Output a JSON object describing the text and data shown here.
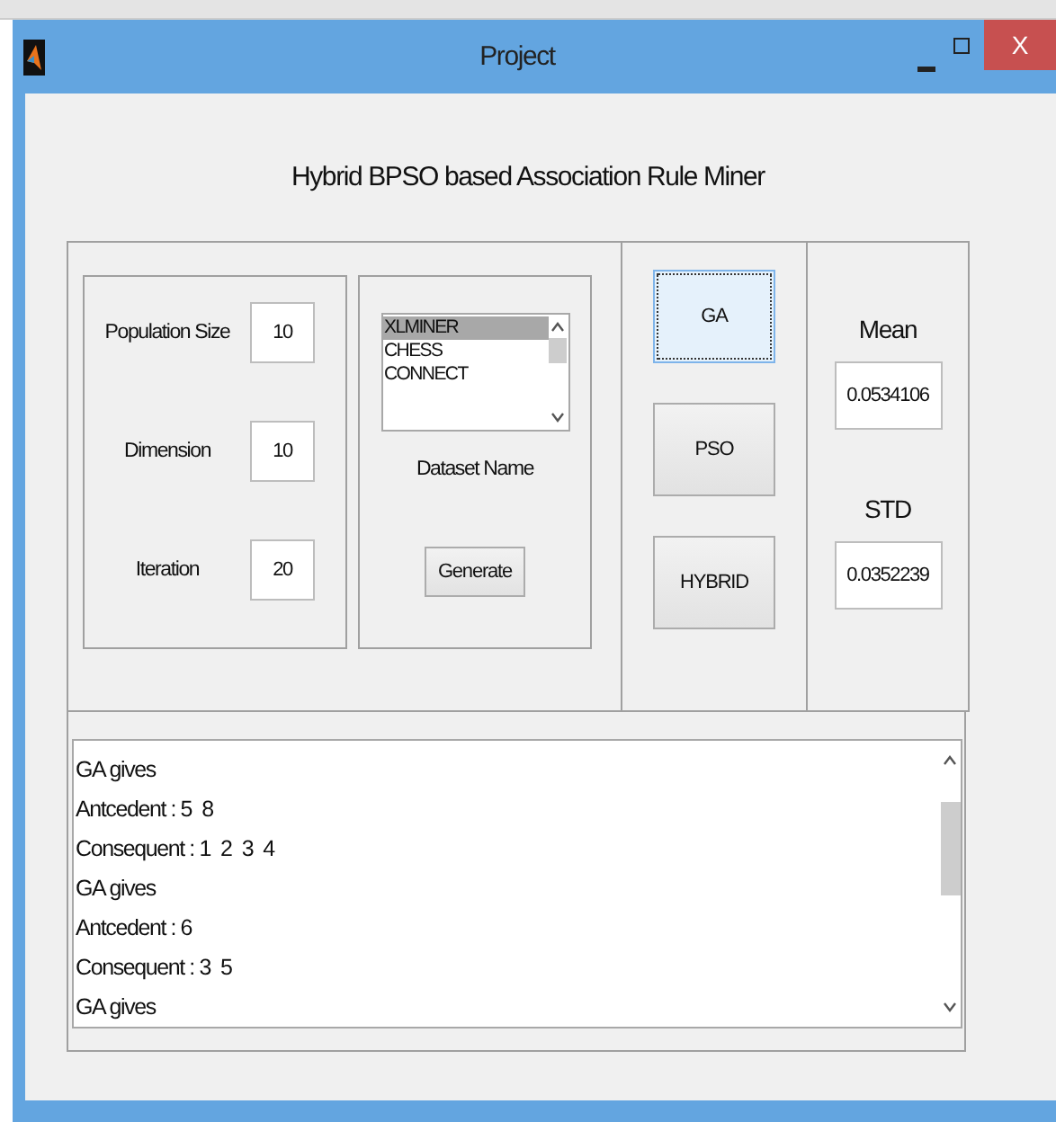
{
  "window": {
    "title": "Project",
    "close_label": "X"
  },
  "heading": "Hybrid BPSO based Association Rule Miner",
  "parameters": [
    {
      "label": "Population Size",
      "value": "10"
    },
    {
      "label": "Dimension",
      "value": "10"
    },
    {
      "label": "Iteration",
      "value": "20"
    }
  ],
  "dataset": {
    "items": [
      {
        "label": "XLMINER",
        "selected": true
      },
      {
        "label": "CHESS",
        "selected": false
      },
      {
        "label": "CONNECT",
        "selected": false
      }
    ],
    "caption": "Dataset Name",
    "button": "Generate"
  },
  "algorithms": [
    {
      "label": "GA",
      "focused": true
    },
    {
      "label": "PSO",
      "focused": false
    },
    {
      "label": "HYBRID",
      "focused": false
    }
  ],
  "stats": [
    {
      "label": "Mean",
      "value": "0.0534106"
    },
    {
      "label": "STD",
      "value": "0.0352239"
    }
  ],
  "output": {
    "lines": [
      "GA gives",
      "Antcedent : 5  8",
      "Consequent : 1  2  3  4",
      "GA gives",
      "Antcedent : 6",
      "Consequent : 3  5",
      "GA gives"
    ]
  }
}
